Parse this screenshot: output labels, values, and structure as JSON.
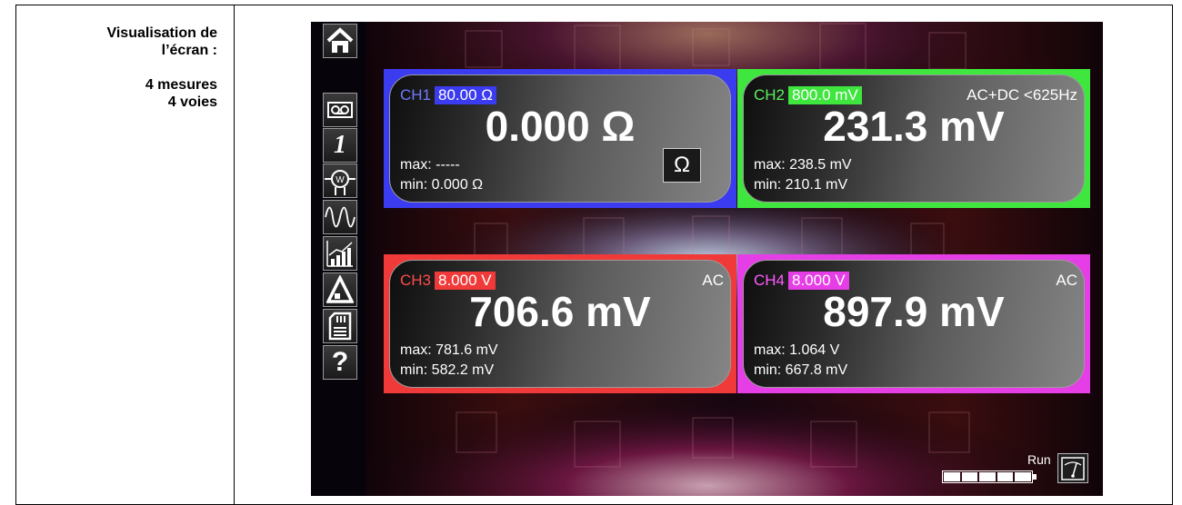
{
  "caption": {
    "line1": "Visualisation de",
    "line2": "l’écran :",
    "line3": "4 mesures",
    "line4": "4 voies"
  },
  "toolbar": {
    "items": [
      {
        "icon": "home-icon"
      },
      {
        "icon": "recorder-icon"
      },
      {
        "icon": "single-measure-icon",
        "label": "1"
      },
      {
        "icon": "wattmeter-icon",
        "label": "W"
      },
      {
        "icon": "waveform-icon"
      },
      {
        "icon": "trend-chart-icon"
      },
      {
        "icon": "delta-icon"
      },
      {
        "icon": "memory-card-icon"
      },
      {
        "icon": "help-icon",
        "label": "?"
      }
    ]
  },
  "channels": [
    {
      "label": "CH1",
      "range": "80.00 Ω",
      "mode": "",
      "value": "0.000 Ω",
      "max": "max: -----",
      "min": "min: 0.000 Ω",
      "unit_button": "Ω",
      "color": "#3b3bf0",
      "label_color": "#6f7bff"
    },
    {
      "label": "CH2",
      "range": "800.0 mV",
      "mode": "AC+DC <625Hz",
      "value": "231.3 mV",
      "max": "max: 238.5 mV",
      "min": "min: 210.1 mV",
      "color": "#3ee63e",
      "label_color": "#5cf05c"
    },
    {
      "label": "CH3",
      "range": "8.000 V",
      "mode": "AC",
      "value": "706.6 mV",
      "max": "max: 781.6 mV",
      "min": "min: 582.2 mV",
      "color": "#f03a3a",
      "label_color": "#ff4a4a"
    },
    {
      "label": "CH4",
      "range": "8.000 V",
      "mode": "AC",
      "value": "897.9 mV",
      "max": "max: 1.064 V",
      "min": "min: 667.8 mV",
      "color": "#e63ee6",
      "label_color": "#ff5cff"
    }
  ],
  "status": {
    "run_label": "Run",
    "battery_icon": "battery-icon",
    "battery_level": 1.0,
    "meter_icon": "analog-meter-icon"
  }
}
